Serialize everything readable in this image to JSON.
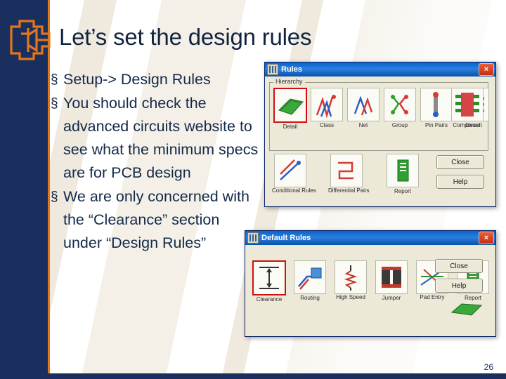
{
  "slide": {
    "title": "Let’s set the design rules",
    "page_number": "26",
    "bullet_marker": "§",
    "bullets": [
      "Setup-> Design Rules",
      "You should check the advanced circuits website to see what the minimum specs are for PCB design",
      "We are only concerned with the “Clearance” section under “Design Rules”"
    ]
  },
  "dialog_rules": {
    "title": "Rules",
    "close_label": "×",
    "group_label": "Hierarchy",
    "tools": [
      {
        "label": "Detail",
        "icon": "board-icon",
        "selected": true
      },
      {
        "label": "Class",
        "icon": "traces-icon",
        "selected": false
      },
      {
        "label": "Net",
        "icon": "net-icon",
        "selected": false
      },
      {
        "label": "Group",
        "icon": "group-icon",
        "selected": false
      },
      {
        "label": "Pin Pairs",
        "icon": "pin-pairs-icon",
        "selected": false
      },
      {
        "label": "Decal",
        "icon": "decal-icon",
        "selected": false
      },
      {
        "label": "Component",
        "icon": "component-icon",
        "selected": false
      }
    ],
    "tools2": [
      {
        "label": "Conditional Rules",
        "icon": "conditional-rules-icon"
      },
      {
        "label": "Differential Pairs",
        "icon": "differential-pairs-icon"
      },
      {
        "label": "Report",
        "icon": "report-icon"
      }
    ],
    "buttons": [
      {
        "label": "Close",
        "name": "close-button"
      },
      {
        "label": "Help",
        "name": "help-button"
      }
    ]
  },
  "dialog_default_rules": {
    "title": "Default Rules",
    "close_label": "×",
    "tools": [
      {
        "label": "Clearance",
        "icon": "clearance-icon",
        "selected": true
      },
      {
        "label": "Routing",
        "icon": "routing-icon",
        "selected": false
      },
      {
        "label": "High Speed",
        "icon": "high-speed-icon",
        "selected": false
      },
      {
        "label": "Jumper",
        "icon": "jumper-icon",
        "selected": false
      },
      {
        "label": "Pad Entry",
        "icon": "pad-entry-icon",
        "selected": false
      },
      {
        "label": "Report",
        "icon": "report-icon",
        "selected": false
      }
    ],
    "buttons": [
      {
        "label": "Close",
        "name": "close-button"
      },
      {
        "label": "Help",
        "name": "help-button"
      }
    ]
  }
}
